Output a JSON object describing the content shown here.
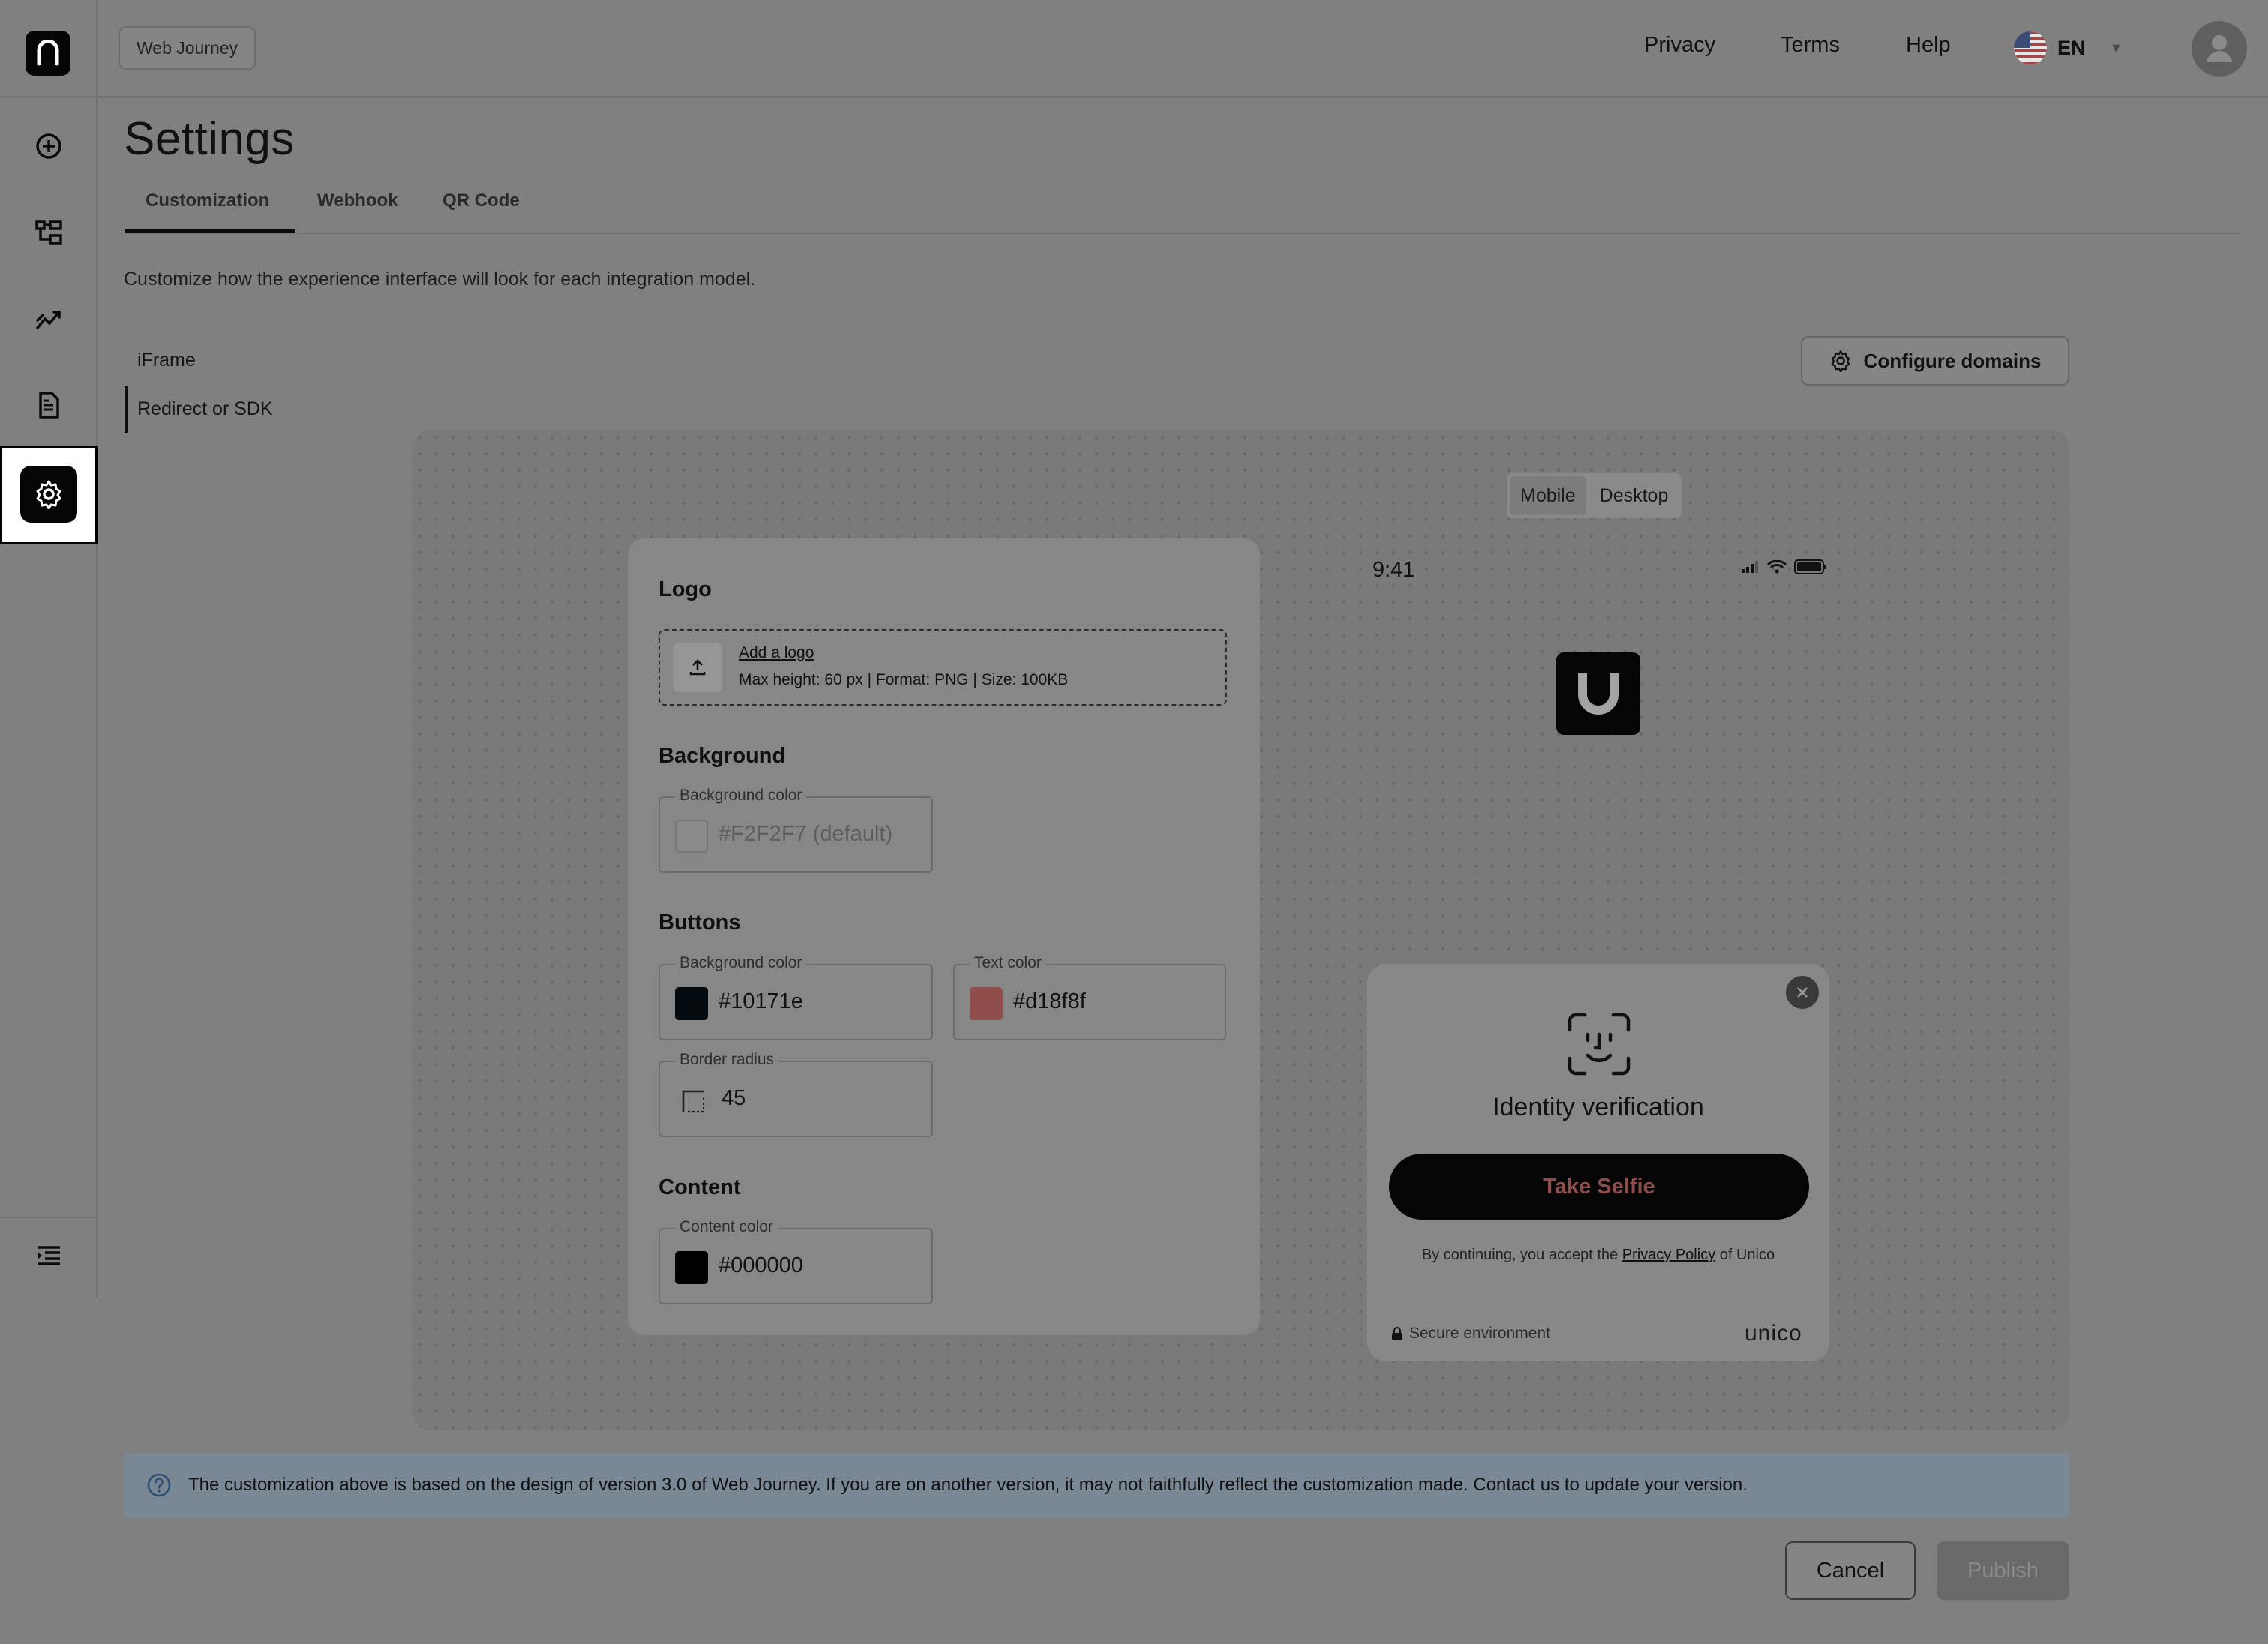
{
  "header": {
    "journey_badge": "Web Journey",
    "links": [
      "Privacy",
      "Terms",
      "Help"
    ],
    "language": "EN"
  },
  "sidebar": {
    "icons": [
      "logo-icon",
      "add-circle-icon",
      "flow-icon",
      "analytics-icon",
      "document-icon",
      "gear-icon",
      "menu-collapse-icon"
    ]
  },
  "page": {
    "title": "Settings",
    "tabs": [
      "Customization",
      "Webhook",
      "QR Code"
    ],
    "description": "Customize how the experience interface will look for each integration model."
  },
  "models": [
    "iFrame",
    "Redirect or SDK"
  ],
  "configure_domains_label": "Configure domains",
  "device_toggle": [
    "Mobile",
    "Desktop"
  ],
  "form": {
    "logo": {
      "title": "Logo",
      "link": "Add a logo",
      "hint": "Max height: 60 px | Format: PNG | Size: 100KB"
    },
    "background": {
      "title": "Background",
      "label": "Background color",
      "value": "#F2F2F7 (default)",
      "swatch": "#8a8a8a"
    },
    "buttons": {
      "title": "Buttons",
      "bg_label": "Background color",
      "bg_value": "#10171e",
      "text_label": "Text color",
      "text_value": "#d18f8f",
      "radius_label": "Border radius",
      "radius_value": "45"
    },
    "content": {
      "title": "Content",
      "label": "Content color",
      "value": "#000000"
    }
  },
  "preview": {
    "time": "9:41",
    "modal_title": "Identity verification",
    "button_label": "Take Selfie",
    "consent_prefix": "By continuing, you accept the ",
    "consent_link": "Privacy Policy",
    "consent_suffix": " of Unico",
    "secure": "Secure environment",
    "brand": "unico"
  },
  "info": "The customization above is based on the design of version 3.0 of Web Journey. If you are on another version, it may not faithfully reflect the customization made. Contact us to update your version.",
  "footer": {
    "cancel": "Cancel",
    "publish": "Publish"
  }
}
